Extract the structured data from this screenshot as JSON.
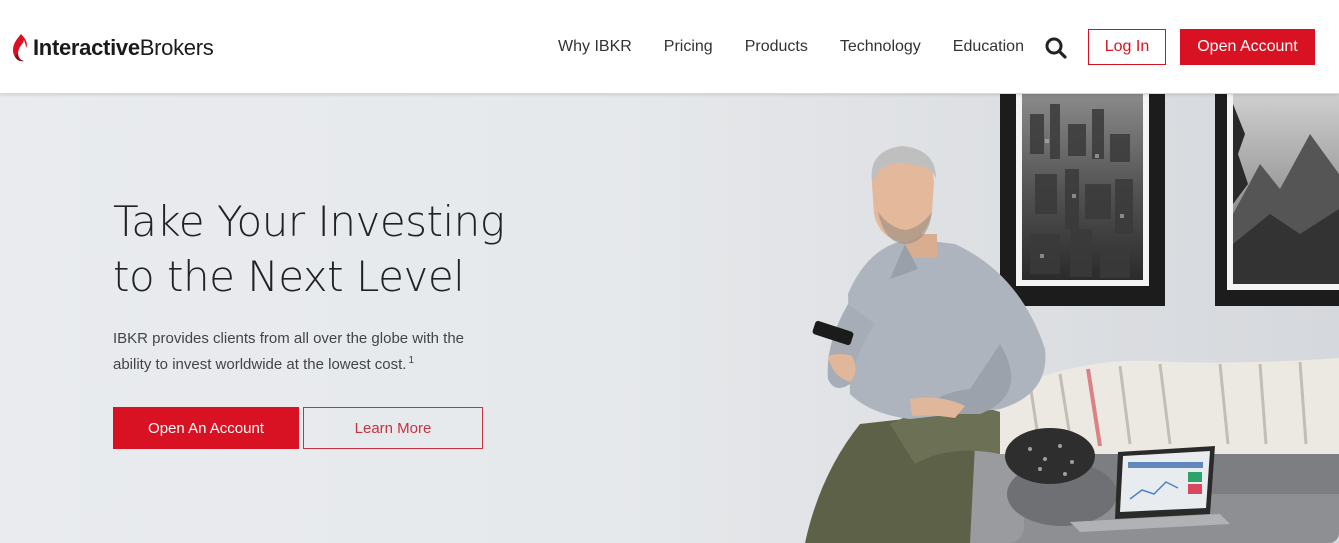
{
  "header": {
    "logo": {
      "bold": "Interactive",
      "regular": "Brokers",
      "brand_color": "#d81222"
    },
    "nav": [
      "Why IBKR",
      "Pricing",
      "Products",
      "Technology",
      "Education"
    ],
    "search_icon": "search-icon",
    "login_label": "Log In",
    "open_account_label": "Open Account"
  },
  "hero": {
    "title_line1": "Take Your Investing",
    "title_line2": "to the Next Level",
    "description": "IBKR provides clients from all over the globe with the ability to invest worldwide at the lowest cost.",
    "footnote": "1",
    "primary_button": "Open An Account",
    "secondary_button": "Learn More"
  },
  "colors": {
    "accent": "#d81222",
    "text": "#222222"
  }
}
